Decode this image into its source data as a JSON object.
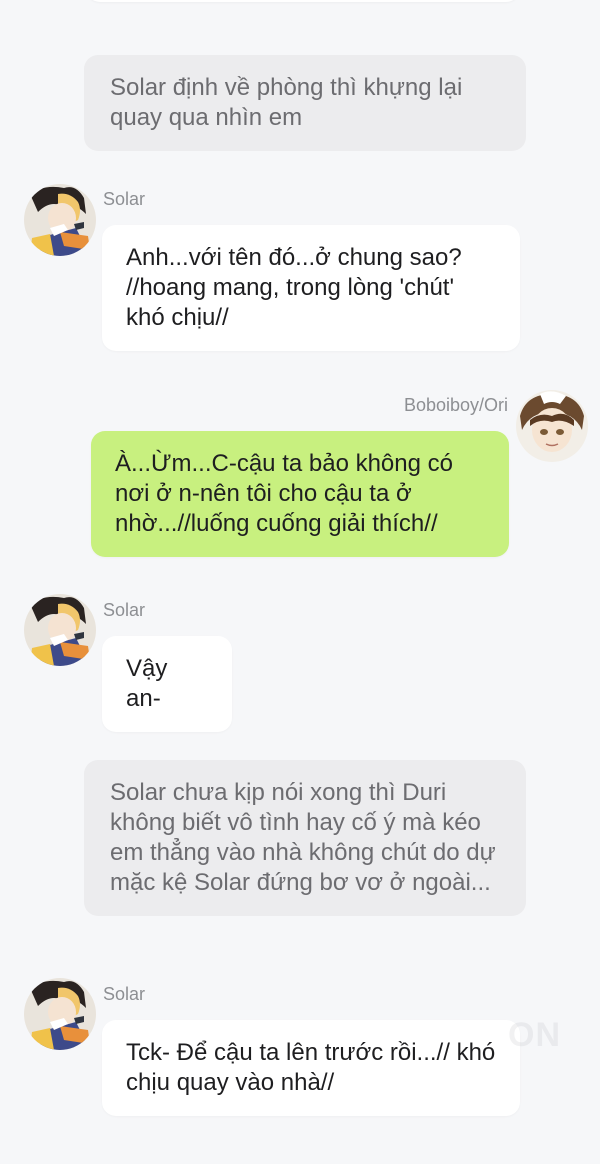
{
  "narration_1": "Solar định về phòng thì khựng lại quay qua nhìn em",
  "messages": [
    {
      "speaker": "Solar",
      "text": "Anh...với tên đó...ở chung sao? //hoang mang, trong lòng 'chút' khó chịu//"
    },
    {
      "speaker": "Boboiboy/Ori",
      "text": "À...Ừm...C-cậu ta bảo không có nơi ở n-nên tôi cho cậu ta ở nhờ...//luống cuống giải thích//"
    },
    {
      "speaker": "Solar",
      "text": "Vậy an-"
    },
    {
      "speaker": "Solar",
      "text": "Tck- Để cậu ta lên trước rồi...// khó chịu quay vào nhà//"
    }
  ],
  "narration_2": "Solar chưa kịp nói xong thì Duri không biết vô tình hay cố ý mà kéo em thẳng vào nhà không chút do dự mặc kệ Solar đứng bơ vơ ở ngoài...",
  "watermark": "ON",
  "colors": {
    "background": "#f6f7f9",
    "narration_bg": "#ececee",
    "bubble_bg": "#ffffff",
    "user_bubble_bg": "#c8f07f",
    "name_color": "#8d8f93"
  }
}
